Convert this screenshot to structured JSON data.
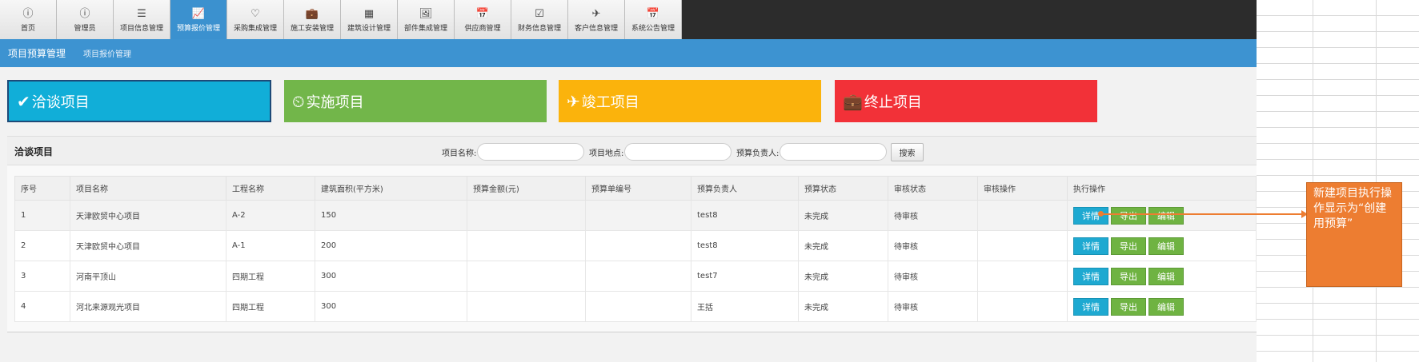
{
  "nav": {
    "tabs": [
      {
        "label": "首页",
        "icon": "info-icon",
        "glyph": "ⓘ"
      },
      {
        "label": "管理员",
        "icon": "info-icon",
        "glyph": "ⓘ"
      },
      {
        "label": "项目信息管理",
        "icon": "list-icon",
        "glyph": "☰"
      },
      {
        "label": "预算报价管理",
        "icon": "chart-icon",
        "glyph": "📈",
        "active": true
      },
      {
        "label": "采购集成管理",
        "icon": "heart-icon",
        "glyph": "♡"
      },
      {
        "label": "施工安装管理",
        "icon": "briefcase-icon",
        "glyph": "💼"
      },
      {
        "label": "建筑设计管理",
        "icon": "grid-icon",
        "glyph": "▦"
      },
      {
        "label": "部件集成管理",
        "icon": "image-icon",
        "glyph": "🖼"
      },
      {
        "label": "供应商管理",
        "icon": "calendar-icon",
        "glyph": "📅"
      },
      {
        "label": "财务信息管理",
        "icon": "checklist-icon",
        "glyph": "☑"
      },
      {
        "label": "客户信息管理",
        "icon": "plane-icon",
        "glyph": "✈"
      },
      {
        "label": "系统公告管理",
        "icon": "calendar-icon",
        "glyph": "📅"
      }
    ]
  },
  "subnav": {
    "active": "项目预算管理",
    "item": "项目报价管理"
  },
  "tiles": [
    {
      "label": "洽谈项目",
      "glyph": "✔",
      "icon": "abc-check-icon",
      "color": "#11aed8"
    },
    {
      "label": "实施项目",
      "glyph": "⏲",
      "icon": "dashboard-icon",
      "color": "#72b64a"
    },
    {
      "label": "竣工项目",
      "glyph": "✈",
      "icon": "plane-icon",
      "color": "#fbb30c"
    },
    {
      "label": "终止项目",
      "glyph": "💼",
      "icon": "toolbox-icon",
      "color": "#f23138"
    }
  ],
  "panel": {
    "title": "洽谈项目",
    "filters": {
      "name_label": "项目名称:",
      "location_label": "项目地点:",
      "owner_label": "预算负责人:"
    },
    "search_label": "搜索"
  },
  "table": {
    "headers": [
      "序号",
      "项目名称",
      "工程名称",
      "建筑面积(平方米)",
      "预算金额(元)",
      "预算单编号",
      "预算负责人",
      "预算状态",
      "审核状态",
      "审核操作",
      "执行操作"
    ],
    "rows": [
      {
        "no": "1",
        "project": "天津欧贸中心项目",
        "engineering": "A-2",
        "area": "150",
        "amount": "",
        "budget_no": "",
        "owner": "test8",
        "budget_status": "未完成",
        "audit_status": "待审核",
        "audit_op": ""
      },
      {
        "no": "2",
        "project": "天津欧贸中心项目",
        "engineering": "A-1",
        "area": "200",
        "amount": "",
        "budget_no": "",
        "owner": "test8",
        "budget_status": "未完成",
        "audit_status": "待审核",
        "audit_op": ""
      },
      {
        "no": "3",
        "project": "河南平顶山",
        "engineering": "四期工程",
        "area": "300",
        "amount": "",
        "budget_no": "",
        "owner": "test7",
        "budget_status": "未完成",
        "audit_status": "待审核",
        "audit_op": ""
      },
      {
        "no": "4",
        "project": "河北来源观光项目",
        "engineering": "四期工程",
        "area": "300",
        "amount": "",
        "budget_no": "",
        "owner": "王括",
        "budget_status": "未完成",
        "audit_status": "待审核",
        "audit_op": ""
      }
    ],
    "actions": {
      "detail": "详情",
      "export": "导出",
      "edit": "编辑"
    }
  },
  "annotation": {
    "text": "新建项目执行操作显示为“创建用预算”",
    "color": "#ed7d31"
  }
}
